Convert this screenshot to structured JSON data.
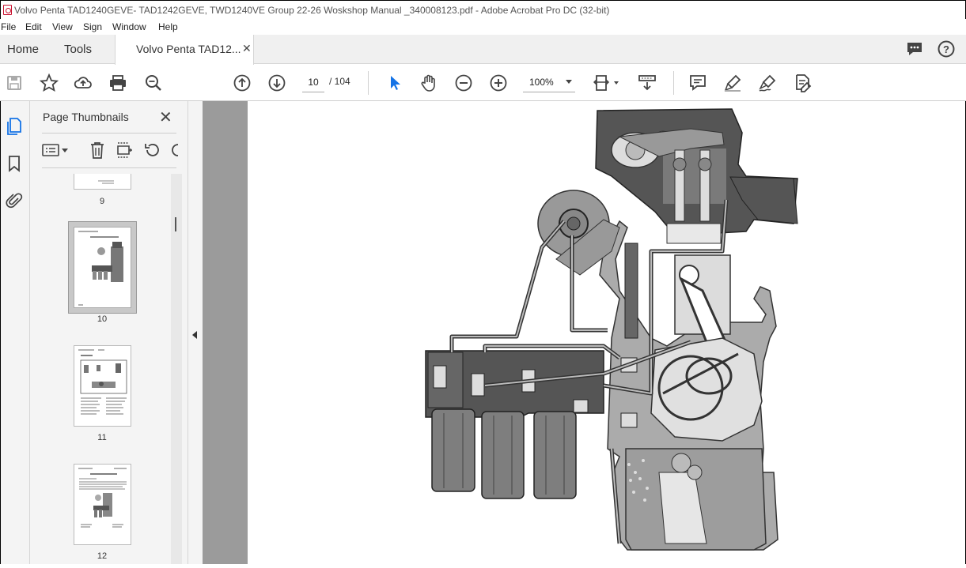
{
  "window": {
    "title": "Volvo Penta TAD1240GEVE- TAD1242GEVE, TWD1240VE Group 22-26 Woskshop Manual _340008123.pdf - Adobe Acrobat Pro DC (32-bit)"
  },
  "menu": [
    "File",
    "Edit",
    "View",
    "Sign",
    "Window",
    "Help"
  ],
  "tabs": {
    "home": "Home",
    "tools": "Tools",
    "document": "Volvo Penta TAD12...",
    "close": "✕"
  },
  "toolbar": {
    "current_page": "10",
    "total_pages": "/ 104",
    "zoom": "100%"
  },
  "thumbnails": {
    "title": "Page Thumbnails",
    "close": "✕",
    "pages": [
      {
        "number": "9"
      },
      {
        "number": "10",
        "selected": true
      },
      {
        "number": "11"
      },
      {
        "number": "12"
      }
    ]
  },
  "colors": {
    "accent": "#1473e6",
    "doc_bg": "#9b9b9b",
    "engine_dark": "#555555",
    "engine_mid": "#8a8a8a",
    "engine_light": "#bdbdbd"
  }
}
